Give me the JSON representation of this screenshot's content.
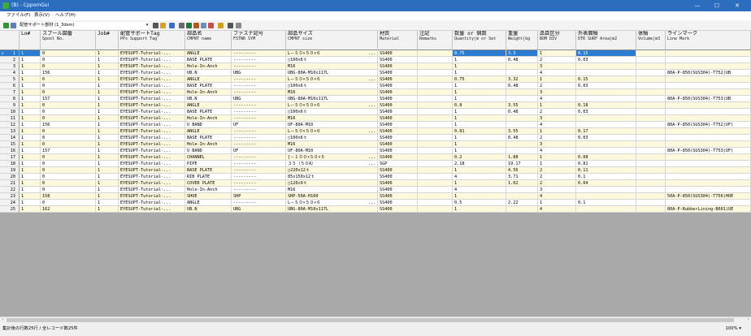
{
  "window": {
    "title": "(B) - CppomGui",
    "minimize": "—",
    "maximize": "☐",
    "close": "✕"
  },
  "menu": [
    {
      "label": "ファイル(F)"
    },
    {
      "label": "表示(V)"
    },
    {
      "label": "ヘルプ(H)"
    }
  ],
  "toolbar": {
    "combo_value": "配管サポート部材 (1_3dsm)",
    "icons": [
      "save-icon",
      "new-icon",
      "search-icon",
      "star-icon",
      "grid-icon",
      "document-icon",
      "excel-icon",
      "copy-icon",
      "filter-icon",
      "sort-icon",
      "bar-icon",
      "find-icon",
      "undo-icon"
    ],
    "icon_colors": [
      "#3a8f3a",
      "#5a7fb5",
      "#555555",
      "#e0a020",
      "#3f6fb8",
      "#6a6a6a",
      "#1d7a3a",
      "#b05a2a",
      "#6a8fc0",
      "#c05050",
      "#d0a020",
      "#555555",
      "#8a8a8a"
    ]
  },
  "columns": [
    {
      "key": "lno",
      "jp": "Lo#",
      "en": ""
    },
    {
      "key": "spool",
      "jp": "スプール図番",
      "en": "Spool No."
    },
    {
      "key": "job",
      "jp": "Job#",
      "en": ""
    },
    {
      "key": "tag",
      "jp": "配管サポートTag",
      "en": "PPs Support Tag"
    },
    {
      "key": "part",
      "jp": "部品名",
      "en": "CMPNT name"
    },
    {
      "key": "fastener",
      "jp": "ファスナ記号",
      "en": "FSTNR SYM"
    },
    {
      "key": "size",
      "jp": "部品サイズ",
      "en": "CMPNT size"
    },
    {
      "key": "material",
      "jp": "材質",
      "en": "Material"
    },
    {
      "key": "remarks",
      "jp": "注記",
      "en": "Remarks"
    },
    {
      "key": "qty",
      "jp": "数量 or 個数",
      "en": "Quantity|m or Set"
    },
    {
      "key": "weight",
      "jp": "重量",
      "en": "Weight|kg"
    },
    {
      "key": "bom",
      "jp": "品目区分",
      "en": "BOM DIV"
    },
    {
      "key": "area",
      "jp": "外表面積",
      "en": "OTR SURF Area|m2"
    },
    {
      "key": "volume",
      "jp": "体積",
      "en": "Volume|m3"
    },
    {
      "key": "linemark",
      "jp": "ラインマーク",
      "en": "Line Mark"
    }
  ],
  "rows": [
    {
      "n": "1",
      "lno": "1",
      "spool": "0",
      "job": "1",
      "tag": "EYESUPT-Tutorial-...",
      "part": "ANGLE",
      "fastener": "---------",
      "size": "L－５０×５０×６",
      "size_more": true,
      "material": "SS400",
      "remarks": "",
      "qty": "0.75",
      "weight": "3.3",
      "bom": "1",
      "area": "0.15",
      "volume": "",
      "linemark": ""
    },
    {
      "n": "2",
      "lno": "1",
      "spool": "0",
      "job": "1",
      "tag": "EYESUPT-Tutorial-...",
      "part": "BASE PLATE",
      "fastener": "---------",
      "size": "□100x6ｔ",
      "size_more": false,
      "material": "SS400",
      "remarks": "",
      "qty": "1",
      "weight": "0.48",
      "bom": "2",
      "area": "0.03",
      "volume": "",
      "linemark": ""
    },
    {
      "n": "3",
      "lno": "1",
      "spool": "0",
      "job": "1",
      "tag": "EYESUPT-Tutorial-...",
      "part": "Hole-In-Anch",
      "fastener": "---------",
      "size": "M16",
      "size_more": false,
      "material": "SS400",
      "remarks": "",
      "qty": "1",
      "weight": "",
      "bom": "3",
      "area": "",
      "volume": "",
      "linemark": ""
    },
    {
      "n": "4",
      "lno": "1",
      "spool": "156",
      "job": "1",
      "tag": "EYESUPT-Tutorial-...",
      "part": "UB.N",
      "fastener": "UBG",
      "size": "UBG-80A-M10x117L",
      "size_more": false,
      "material": "SS400",
      "remarks": "",
      "qty": "1",
      "weight": "",
      "bom": "4",
      "area": "",
      "volume": "",
      "linemark": "80A-P-850(SUS304)-T752(UB"
    },
    {
      "n": "5",
      "lno": "1",
      "spool": "0",
      "job": "1",
      "tag": "EYESUPT-Tutorial-...",
      "part": "ANGLE",
      "fastener": "---------",
      "size": "L－５０×５０×６",
      "size_more": true,
      "material": "SS400",
      "remarks": "",
      "qty": "0.75",
      "weight": "3.32",
      "bom": "1",
      "area": "0.15",
      "volume": "",
      "linemark": ""
    },
    {
      "n": "6",
      "lno": "1",
      "spool": "0",
      "job": "1",
      "tag": "EYESUPT-Tutorial-...",
      "part": "BASE PLATE",
      "fastener": "---------",
      "size": "□100x6ｔ",
      "size_more": false,
      "material": "SS400",
      "remarks": "",
      "qty": "1",
      "weight": "0.48",
      "bom": "2",
      "area": "0.03",
      "volume": "",
      "linemark": ""
    },
    {
      "n": "7",
      "lno": "1",
      "spool": "0",
      "job": "1",
      "tag": "EYESUPT-Tutorial-...",
      "part": "Hole-In-Anch",
      "fastener": "---------",
      "size": "M16",
      "size_more": false,
      "material": "SS400",
      "remarks": "",
      "qty": "1",
      "weight": "",
      "bom": "3",
      "area": "",
      "volume": "",
      "linemark": ""
    },
    {
      "n": "8",
      "lno": "1",
      "spool": "157",
      "job": "1",
      "tag": "EYESUPT-Tutorial-...",
      "part": "UB.N",
      "fastener": "UBG",
      "size": "UBG-80A-M10x117L",
      "size_more": false,
      "material": "SS400",
      "remarks": "",
      "qty": "1",
      "weight": "",
      "bom": "4",
      "area": "",
      "volume": "",
      "linemark": "80A-P-850(SUS304)-T753(UB"
    },
    {
      "n": "9",
      "lno": "1",
      "spool": "0",
      "job": "1",
      "tag": "EYESUPT-Tutorial-...",
      "part": "ANGLE",
      "fastener": "---------",
      "size": "L－５０×５０×６",
      "size_more": true,
      "material": "SS400",
      "remarks": "",
      "qty": "0.8",
      "weight": "3.55",
      "bom": "1",
      "area": "0.18",
      "volume": "",
      "linemark": ""
    },
    {
      "n": "10",
      "lno": "1",
      "spool": "0",
      "job": "1",
      "tag": "EYESUPT-Tutorial-...",
      "part": "BASE PLATE",
      "fastener": "---------",
      "size": "□100x6ｔ",
      "size_more": false,
      "material": "SS400",
      "remarks": "",
      "qty": "1",
      "weight": "0.48",
      "bom": "2",
      "area": "0.03",
      "volume": "",
      "linemark": ""
    },
    {
      "n": "11",
      "lno": "1",
      "spool": "0",
      "job": "1",
      "tag": "EYESUPT-Tutorial-...",
      "part": "Hole-In-Anch",
      "fastener": "---------",
      "size": "M16",
      "size_more": false,
      "material": "SS400",
      "remarks": "",
      "qty": "1",
      "weight": "",
      "bom": "3",
      "area": "",
      "volume": "",
      "linemark": ""
    },
    {
      "n": "12",
      "lno": "1",
      "spool": "156",
      "job": "1",
      "tag": "EYESUPT-Tutorial-...",
      "part": "U BAND",
      "fastener": "UF",
      "size": "UF-80A-M10",
      "size_more": false,
      "material": "SS400",
      "remarks": "",
      "qty": "1",
      "weight": "",
      "bom": "4",
      "area": "",
      "volume": "",
      "linemark": "80A-P-850(SUS304)-T752(UF)"
    },
    {
      "n": "13",
      "lno": "1",
      "spool": "0",
      "job": "1",
      "tag": "EYESUPT-Tutorial-...",
      "part": "ANGLE",
      "fastener": "---------",
      "size": "L－５０×５０×６",
      "size_more": true,
      "material": "SS400",
      "remarks": "",
      "qty": "0.81",
      "weight": "3.55",
      "bom": "1",
      "area": "0.17",
      "volume": "",
      "linemark": ""
    },
    {
      "n": "14",
      "lno": "1",
      "spool": "0",
      "job": "1",
      "tag": "EYESUPT-Tutorial-...",
      "part": "BASE PLATE",
      "fastener": "---------",
      "size": "□100x6ｔ",
      "size_more": false,
      "material": "SS400",
      "remarks": "",
      "qty": "1",
      "weight": "0.48",
      "bom": "2",
      "area": "0.03",
      "volume": "",
      "linemark": ""
    },
    {
      "n": "15",
      "lno": "1",
      "spool": "0",
      "job": "1",
      "tag": "EYESUPT-Tutorial-...",
      "part": "Hole-In-Anch",
      "fastener": "---------",
      "size": "M16",
      "size_more": false,
      "material": "SS400",
      "remarks": "",
      "qty": "1",
      "weight": "",
      "bom": "3",
      "area": "",
      "volume": "",
      "linemark": ""
    },
    {
      "n": "16",
      "lno": "1",
      "spool": "157",
      "job": "1",
      "tag": "EYESUPT-Tutorial-...",
      "part": "U BAND",
      "fastener": "UF",
      "size": "UF-80A-M10",
      "size_more": false,
      "material": "SS400",
      "remarks": "",
      "qty": "1",
      "weight": "",
      "bom": "4",
      "area": "",
      "volume": "",
      "linemark": "80A-P-850(SUS304)-T753(UF)"
    },
    {
      "n": "17",
      "lno": "1",
      "spool": "0",
      "job": "1",
      "tag": "EYESUPT-Tutorial-...",
      "part": "CHANNEL",
      "fastener": "---------",
      "size": "[－１００×５０×５",
      "size_more": true,
      "material": "SS400",
      "remarks": "",
      "qty": "0.2",
      "weight": "1.88",
      "bom": "1",
      "area": "0.08",
      "volume": "",
      "linemark": ""
    },
    {
      "n": "18",
      "lno": "1",
      "spool": "0",
      "job": "1",
      "tag": "EYESUPT-Tutorial-...",
      "part": "PIPE",
      "fastener": "---------",
      "size": "３５（５０A）",
      "size_more": true,
      "material": "SGP",
      "remarks": "",
      "qty": "2.18",
      "weight": "19.17",
      "bom": "1",
      "area": "0.81",
      "volume": "",
      "linemark": ""
    },
    {
      "n": "19",
      "lno": "1",
      "spool": "0",
      "job": "1",
      "tag": "EYESUPT-Tutorial-...",
      "part": "BASE PLATE",
      "fastener": "---------",
      "size": "□220x12ｔ",
      "size_more": false,
      "material": "SS400",
      "remarks": "",
      "qty": "1",
      "weight": "4.56",
      "bom": "2",
      "area": "0.11",
      "volume": "",
      "linemark": ""
    },
    {
      "n": "20",
      "lno": "1",
      "spool": "0",
      "job": "1",
      "tag": "EYESUPT-Tutorial-...",
      "part": "RIB PLATE",
      "fastener": "---------",
      "size": "85x150x12ｔ",
      "size_more": false,
      "material": "SS400",
      "remarks": "",
      "qty": "4",
      "weight": "3.71",
      "bom": "2",
      "area": "0.1",
      "volume": "",
      "linemark": ""
    },
    {
      "n": "21",
      "lno": "1",
      "spool": "0",
      "job": "1",
      "tag": "EYESUPT-Tutorial-...",
      "part": "COVER PLATE",
      "fastener": "---------",
      "size": "□120x9ｔ",
      "size_more": false,
      "material": "SS400",
      "remarks": "",
      "qty": "1",
      "weight": "1.02",
      "bom": "2",
      "area": "0.04",
      "volume": "",
      "linemark": ""
    },
    {
      "n": "22",
      "lno": "1",
      "spool": "0",
      "job": "1",
      "tag": "EYESUPT-Tutorial-...",
      "part": "Hole-In-Anch",
      "fastener": "---------",
      "size": "M16",
      "size_more": false,
      "material": "SS400",
      "remarks": "",
      "qty": "4",
      "weight": "",
      "bom": "3",
      "area": "",
      "volume": "",
      "linemark": ""
    },
    {
      "n": "23",
      "lno": "1",
      "spool": "158",
      "job": "1",
      "tag": "EYESUPT-Tutorial-...",
      "part": "SHOE",
      "fastener": "SHP",
      "size": "SHP-50A-H100",
      "size_more": false,
      "material": "SS400",
      "remarks": "",
      "qty": "1",
      "weight": "",
      "bom": "4",
      "area": "",
      "volume": "",
      "linemark": "50A-P-850(SUS304)-T756(HOE"
    },
    {
      "n": "24",
      "lno": "1",
      "spool": "0",
      "job": "1",
      "tag": "EYESUPT-Tutorial-...",
      "part": "ANGLE",
      "fastener": "---------",
      "size": "L－５０×５０×６",
      "size_more": true,
      "material": "SS400",
      "remarks": "",
      "qty": "0.5",
      "weight": "2.22",
      "bom": "1",
      "area": "0.1",
      "volume": "",
      "linemark": ""
    },
    {
      "n": "25",
      "lno": "1",
      "spool": "162",
      "job": "1",
      "tag": "EYESUPT-Tutorial-...",
      "part": "UB.N",
      "fastener": "UBG",
      "size": "UBG-80A-M10x117L",
      "size_more": false,
      "material": "SS400",
      "remarks": "",
      "qty": "1",
      "weight": "",
      "bom": "4",
      "area": "",
      "volume": "",
      "linemark": "80A-P-RubberLining-B601(UE"
    }
  ],
  "current_row_marker": "▷",
  "ellipsis": "...",
  "status": {
    "text": "集計後の行数25行 / 全レコード数25件",
    "zoom": "100% ▾"
  },
  "scroll": {
    "left": "‹",
    "right": "›"
  }
}
